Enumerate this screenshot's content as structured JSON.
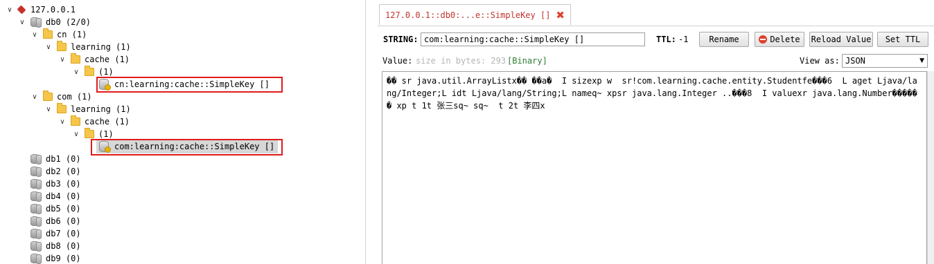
{
  "tree": {
    "server": "127.0.0.1",
    "db0": "db0  (2/0)",
    "cn_folder": "cn  (1)",
    "cn_learning": "learning  (1)",
    "cn_cache": "cache  (1)",
    "cn_empty": " (1)",
    "cn_key": "cn:learning:cache::SimpleKey []",
    "com_folder": "com  (1)",
    "com_learning": "learning  (1)",
    "com_cache": "cache  (1)",
    "com_empty": " (1)",
    "com_key": "com:learning:cache::SimpleKey []",
    "dbs": [
      "db1  (0)",
      "db2  (0)",
      "db3  (0)",
      "db4  (0)",
      "db5  (0)",
      "db6  (0)",
      "db7  (0)",
      "db8  (0)",
      "db9  (0)"
    ]
  },
  "tab": {
    "title": "127.0.0.1::db0:...e::SimpleKey []"
  },
  "toolbar": {
    "type_label": "STRING:",
    "key_value": "com:learning:cache::SimpleKey []",
    "ttl_label": "TTL:",
    "ttl_value": "-1",
    "rename": "Rename",
    "delete": "Delete",
    "reload": "Reload Value",
    "set_ttl": "Set TTL"
  },
  "value_bar": {
    "label": "Value:",
    "size_hint": "size in bytes: 293",
    "binary": "[Binary]",
    "view_as_label": "View as:",
    "view_as_value": "JSON"
  },
  "value_text": "�� sr java.util.ArrayListx�� ��a�  I sizexp w  sr!com.learning.cache.entity.Studentfe���6  L aget Ljava/lang/Integer;L idt Ljava/lang/String;L nameq~ xpsr java.lang.Integer ..���8  I valuexr java.lang.Number������ xp t 1t 张三sq~ sq~  t 2t 李四x",
  "colors": {
    "highlight": "#e01b1b",
    "tab_text": "#c1342e",
    "binary": "#2e7d32",
    "hint": "#b5b5b5"
  }
}
